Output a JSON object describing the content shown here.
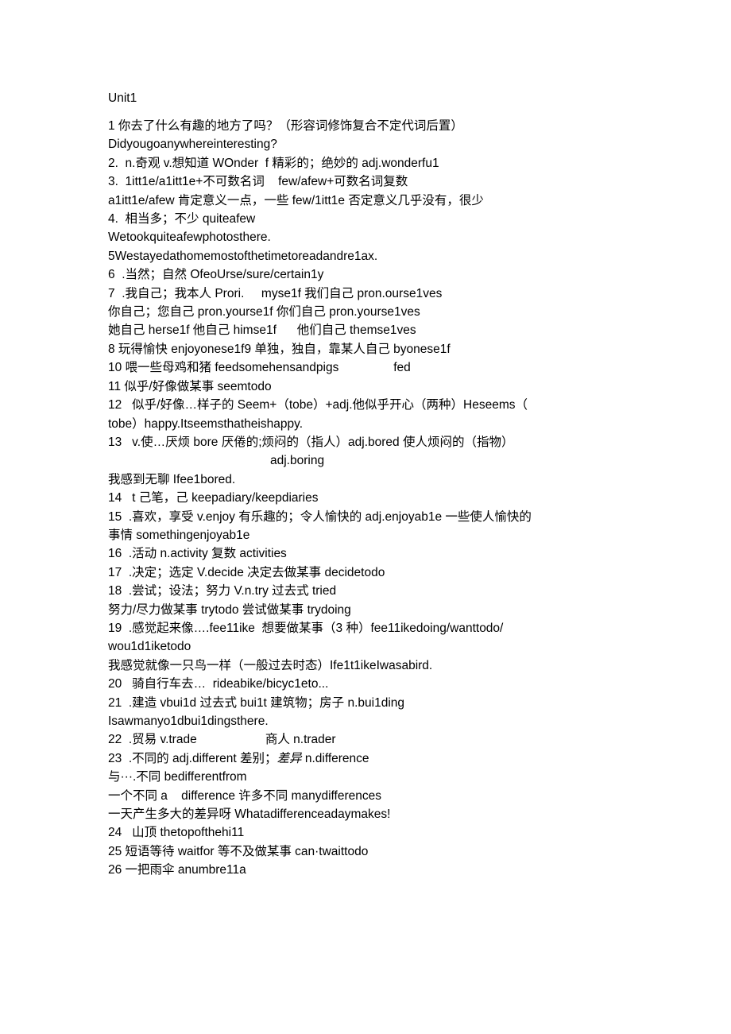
{
  "document": {
    "title": "Unit1",
    "lines": [
      {
        "id": "l1",
        "text": "1 你去了什么有趣的地方了吗？（形容词修饰复合不定代词后置）"
      },
      {
        "id": "l2",
        "text": "Didyougoanywhereinteresting?"
      },
      {
        "id": "l3",
        "text": "2.  n.奇观 v.想知道 WOnder  f 精彩的；绝妙的 adj.wonderfu1"
      },
      {
        "id": "l4",
        "text": "3.  1itt1e/a1itt1e+不可数名词    few/afew+可数名词复数"
      },
      {
        "id": "l5",
        "text": "a1itt1e/afew 肯定意义一点，一些 few/1itt1e 否定意义几乎没有，很少"
      },
      {
        "id": "l6",
        "text": "4.  相当多；不少 quiteafew"
      },
      {
        "id": "l7",
        "text": "Wetookquiteafewphotosthere."
      },
      {
        "id": "l8",
        "text": "5Westayedathomemostofthetimetoreadandre1ax."
      },
      {
        "id": "l9",
        "text": "6  .当然；自然 OfeoUrse/sure/certain1y"
      },
      {
        "id": "l10",
        "text": "7  .我自己；我本人 Prori.     myse1f 我们自己 pron.ourse1ves"
      },
      {
        "id": "l11",
        "text": "你自己；您自己 pron.yourse1f 你们自己 pron.yourse1ves"
      },
      {
        "id": "l12",
        "text": "她自己 herse1f 他自己 himse1f      他们自己 themse1ves"
      },
      {
        "id": "l13",
        "text": "8 玩得愉快 enjoyonese1f9 单独，独自，靠某人自己 byonese1f"
      },
      {
        "id": "l14",
        "text": "10 喂一些母鸡和猪 feedsomehensandpigs                fed"
      },
      {
        "id": "l15",
        "text": "11 似乎/好像做某事 seemtodo"
      },
      {
        "id": "l16",
        "text": "12   似乎/好像…样子的 Seem+（tobe）+adj.他似乎开心（两种）Heseems（"
      },
      {
        "id": "l17",
        "text": "tobe）happy.Itseemsthatheishappy."
      },
      {
        "id": "l18",
        "text": "13   v.使…厌烦 bore 厌倦的;烦闷的（指人）adj.bored 使人烦闷的（指物）"
      },
      {
        "id": "l19",
        "text": "adj.boring",
        "indent": "center"
      },
      {
        "id": "l20",
        "text": "我感到无聊 Ifee1bored."
      },
      {
        "id": "l21",
        "text": "14   t 己笔，己 keepadiary/keepdiaries"
      },
      {
        "id": "l22",
        "text": "15  .喜欢，享受 v.enjoy 有乐趣的；令人愉快的 adj.enjoyab1e 一些使人愉快的"
      },
      {
        "id": "l23",
        "text": "事情 somethingenjoyab1e"
      },
      {
        "id": "l24",
        "text": "16  .活动 n.activity 复数 activities"
      },
      {
        "id": "l25",
        "text": "17  .决定；选定 V.decide 决定去做某事 decidetodo"
      },
      {
        "id": "l26",
        "text": "18  .尝试；设法；努力 V.n.try 过去式 tried"
      },
      {
        "id": "l27",
        "text": "努力/尽力做某事 trytodo 尝试做某事 trydoing"
      },
      {
        "id": "l28",
        "text": "19  .感觉起来像….fee11ike  想要做某事（3 种）fee11ikedoing/wanttodo/"
      },
      {
        "id": "l29",
        "text": "wou1d1iketodo"
      },
      {
        "id": "l30",
        "text": "我感觉就像一只鸟一样（一般过去时态）Ife1t1ikeIwasabird."
      },
      {
        "id": "l31",
        "text": "20   骑自行车去…  rideabike/bicyc1eto..."
      },
      {
        "id": "l32",
        "text": "21  .建造 vbui1d 过去式 bui1t 建筑物；房子 n.bui1ding"
      },
      {
        "id": "l33",
        "text": "Isawmanyo1dbui1dingsthere."
      },
      {
        "id": "l34",
        "text": "22  .贸易 v.trade                    商人 n.trader"
      },
      {
        "id": "l35",
        "text": "23  .不同的 adj.different 差别；",
        "italic_text": "差异",
        "text_after": " n.difference"
      },
      {
        "id": "l36",
        "text": "与···.不同 bedifferentfrom"
      },
      {
        "id": "l37",
        "text": "一个不同 a    difference 许多不同 manydifferences"
      },
      {
        "id": "l38",
        "text": "一天产生多大的差异呀 Whatadifferenceadaymakes!"
      },
      {
        "id": "l39",
        "text": "24   山顶 thetopofthehi11"
      },
      {
        "id": "l40",
        "text": "25 短语等待 waitfor 等不及做某事 can·twaittodo"
      },
      {
        "id": "l41",
        "text": "26 一把雨伞 anumbre11a"
      }
    ]
  }
}
